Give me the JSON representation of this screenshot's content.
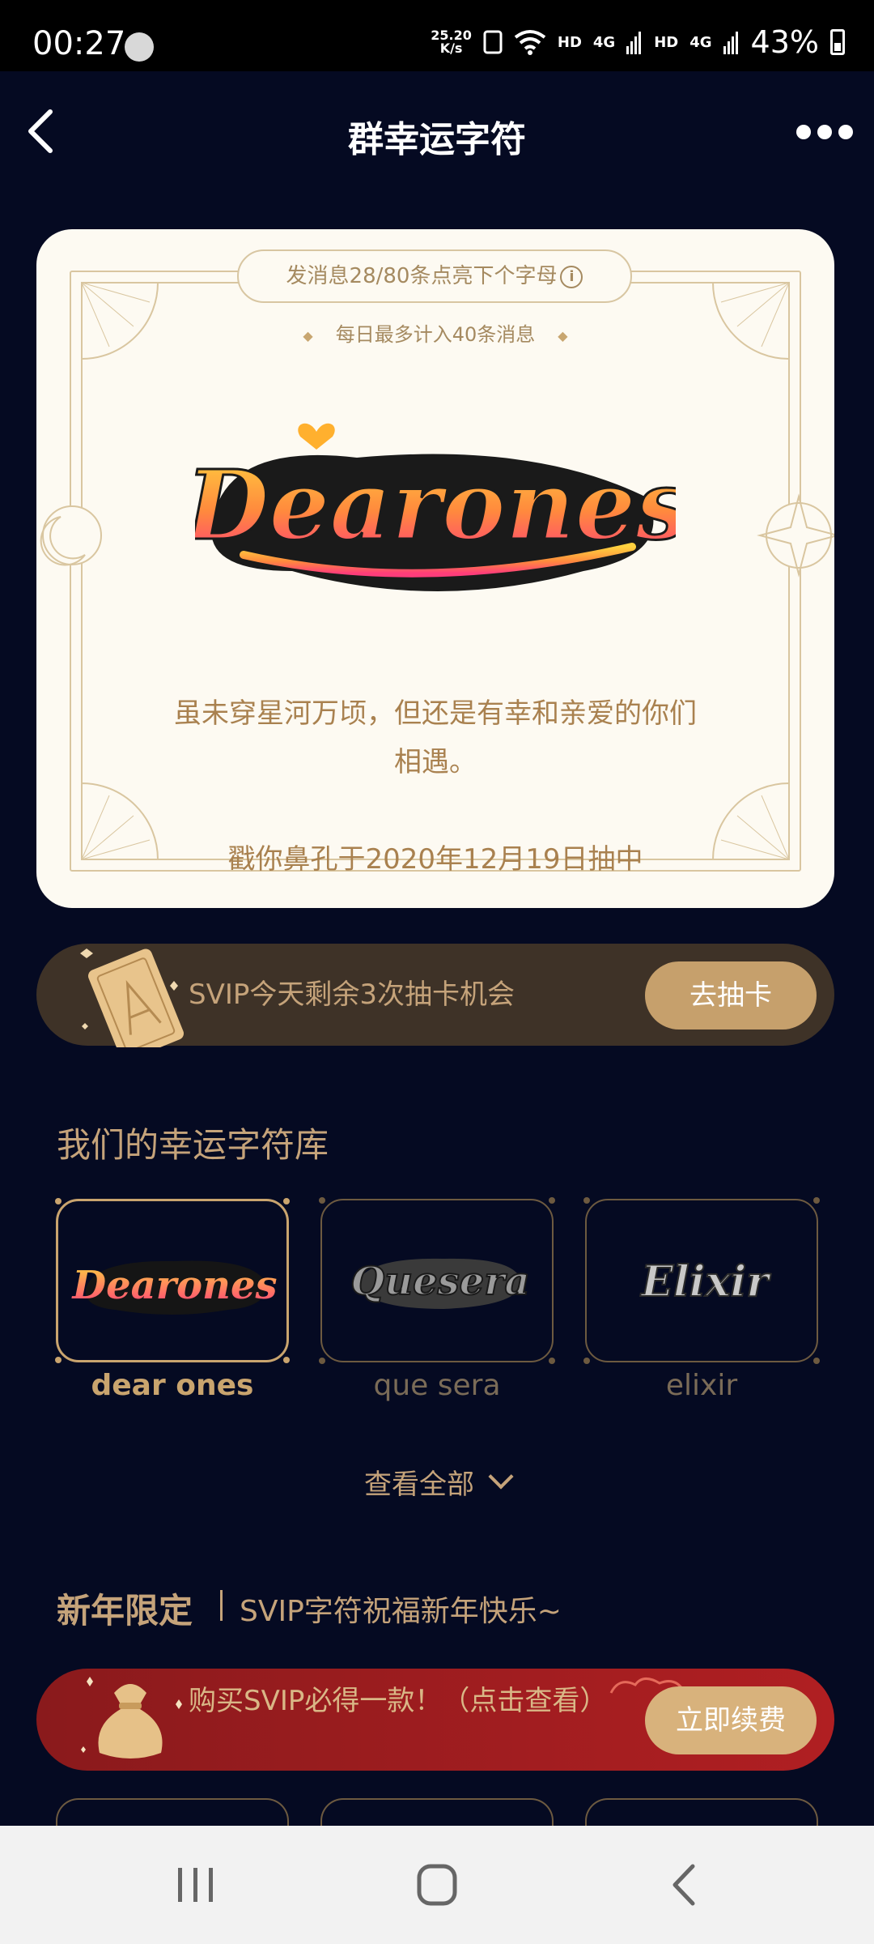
{
  "status_bar": {
    "time": "00:27",
    "net_speed_value": "25.20",
    "net_speed_unit": "K/s",
    "hd1": "HD",
    "sig1": "4G",
    "hd2": "HD",
    "sig2": "4G",
    "battery": "43%"
  },
  "header": {
    "title": "群幸运字符"
  },
  "card": {
    "progress_pill": "发消息28/80条点亮下个字母",
    "daily_limit": "每日最多计入40条消息",
    "logo_text": "Dearones",
    "quote": "虽未穿星河万顷，但还是有幸和亲爱的你们相遇。",
    "drawn_by": "戳你鼻孔于2020年12月19日抽中"
  },
  "svip_draw": {
    "text": "SVIP今天剩余3次抽卡机会",
    "button": "去抽卡"
  },
  "library": {
    "title": "我们的幸运字符库",
    "items": [
      {
        "name": "dear ones",
        "logo": "Dearones",
        "selected": true
      },
      {
        "name": "que sera",
        "logo": "Quesera",
        "selected": false
      },
      {
        "name": "elixir",
        "logo": "Elixir",
        "selected": false
      }
    ],
    "view_all": "查看全部"
  },
  "new_year": {
    "title": "新年限定",
    "subtitle": "SVIP字符祝福新年快乐~",
    "promo_text": "购买SVIP必得一款！（点击查看）",
    "button": "立即续费"
  },
  "colors": {
    "background": "#050a22",
    "gold": "#c5a37a",
    "card_bg": "#fdfaf2",
    "red_promo": "#a01d20"
  }
}
